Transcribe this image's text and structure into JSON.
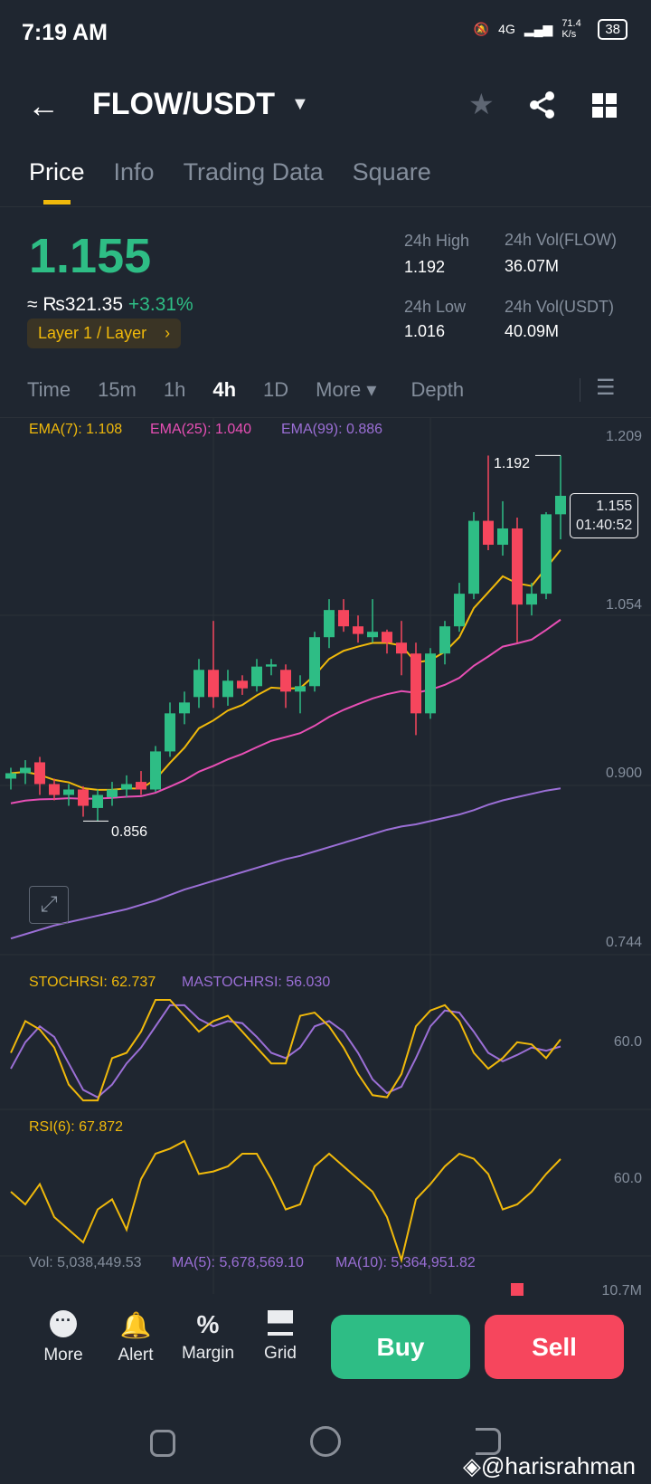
{
  "status": {
    "time": "7:19 AM",
    "net": "4G",
    "speed": "71.4 K/s",
    "battery": "38"
  },
  "header": {
    "title": "FLOW/USDT"
  },
  "tabs": [
    "Price",
    "Info",
    "Trading Data",
    "Square"
  ],
  "ticker": {
    "price": "1.155",
    "fiat": "≈ ₨321.35",
    "change": "+3.31%",
    "tag": "Layer 1 / Layer",
    "high_label": "24h High",
    "high": "1.192",
    "low_label": "24h Low",
    "low": "1.016",
    "volb_label": "24h Vol(FLOW)",
    "volb": "36.07M",
    "volq_label": "24h Vol(USDT)",
    "volq": "40.09M"
  },
  "timeframes": [
    "Time",
    "15m",
    "1h",
    "4h",
    "1D",
    "More",
    "Depth"
  ],
  "legend": {
    "ema7": "EMA(7): 1.108",
    "ema25": "EMA(25): 1.040",
    "ema99": "EMA(99): 0.886",
    "stoch": "STOCHRSI: 62.737",
    "mastoch": "MASTOCHRSI: 56.030",
    "rsi": "RSI(6): 67.872",
    "vol": "Vol: 5,038,449.53",
    "ma5": "MA(5): 5,678,569.10",
    "ma10": "MA(10): 5,364,951.82"
  },
  "axis": {
    "p1": "1.209",
    "p2": "1.054",
    "p3": "0.900",
    "p4": "0.744",
    "stoch": "60.0",
    "rsi": "60.0",
    "vol": "10.7M"
  },
  "markers": {
    "high": "1.192",
    "low": "0.856",
    "last": "1.155",
    "countdown": "01:40:52"
  },
  "bottom": {
    "more": "More",
    "alert": "Alert",
    "margin": "Margin",
    "grid": "Grid",
    "buy": "Buy",
    "sell": "Sell"
  },
  "watermark": "@harisrahman",
  "colors": {
    "up": "#2ebd85",
    "down": "#f6465d",
    "ema7": "#f0b90b",
    "ema25": "#e84fb5",
    "ema99": "#9b6fd6"
  },
  "chart_data": {
    "type": "candlestick",
    "ylim": [
      0.744,
      1.209
    ],
    "candles": [
      [
        0.895,
        0.905,
        0.885,
        0.9
      ],
      [
        0.9,
        0.912,
        0.89,
        0.905
      ],
      [
        0.91,
        0.915,
        0.88,
        0.89
      ],
      [
        0.89,
        0.895,
        0.875,
        0.88
      ],
      [
        0.88,
        0.89,
        0.87,
        0.885
      ],
      [
        0.885,
        0.888,
        0.86,
        0.87
      ],
      [
        0.868,
        0.885,
        0.856,
        0.88
      ],
      [
        0.878,
        0.892,
        0.87,
        0.885
      ],
      [
        0.885,
        0.898,
        0.878,
        0.89
      ],
      [
        0.892,
        0.902,
        0.88,
        0.885
      ],
      [
        0.885,
        0.925,
        0.883,
        0.92
      ],
      [
        0.92,
        0.965,
        0.915,
        0.955
      ],
      [
        0.955,
        0.975,
        0.945,
        0.965
      ],
      [
        0.97,
        1.005,
        0.96,
        0.995
      ],
      [
        0.995,
        1.04,
        0.96,
        0.97
      ],
      [
        0.97,
        0.995,
        0.962,
        0.985
      ],
      [
        0.985,
        0.99,
        0.972,
        0.978
      ],
      [
        0.98,
        1.005,
        0.975,
        0.998
      ],
      [
        0.998,
        1.005,
        0.99,
        1.0
      ],
      [
        0.995,
        1.0,
        0.96,
        0.975
      ],
      [
        0.975,
        0.99,
        0.955,
        0.98
      ],
      [
        0.98,
        1.03,
        0.975,
        1.025
      ],
      [
        1.025,
        1.06,
        1.015,
        1.05
      ],
      [
        1.05,
        1.06,
        1.03,
        1.035
      ],
      [
        1.035,
        1.045,
        1.02,
        1.028
      ],
      [
        1.025,
        1.06,
        1.02,
        1.03
      ],
      [
        1.03,
        1.032,
        1.01,
        1.02
      ],
      [
        1.02,
        1.04,
        0.99,
        1.01
      ],
      [
        1.01,
        1.02,
        0.935,
        0.955
      ],
      [
        0.955,
        1.015,
        0.95,
        1.01
      ],
      [
        1.01,
        1.04,
        1.0,
        1.035
      ],
      [
        1.035,
        1.075,
        1.03,
        1.065
      ],
      [
        1.065,
        1.14,
        1.06,
        1.132
      ],
      [
        1.132,
        1.192,
        1.105,
        1.11
      ],
      [
        1.11,
        1.15,
        1.1,
        1.125
      ],
      [
        1.125,
        1.135,
        1.02,
        1.055
      ],
      [
        1.055,
        1.075,
        1.045,
        1.065
      ],
      [
        1.065,
        1.14,
        1.06,
        1.138
      ],
      [
        1.138,
        1.192,
        1.115,
        1.155
      ]
    ],
    "ema99": [
      0.748,
      0.752,
      0.756,
      0.76,
      0.763,
      0.766,
      0.769,
      0.772,
      0.775,
      0.779,
      0.783,
      0.788,
      0.793,
      0.797,
      0.801,
      0.805,
      0.809,
      0.813,
      0.817,
      0.821,
      0.824,
      0.828,
      0.832,
      0.836,
      0.84,
      0.844,
      0.848,
      0.851,
      0.853,
      0.856,
      0.859,
      0.862,
      0.866,
      0.871,
      0.875,
      0.878,
      0.881,
      0.884,
      0.886
    ],
    "stoch_k": [
      50,
      80,
      72,
      55,
      20,
      5,
      5,
      45,
      50,
      70,
      100,
      100,
      85,
      70,
      80,
      85,
      70,
      55,
      40,
      40,
      85,
      88,
      75,
      55,
      30,
      10,
      8,
      30,
      75,
      90,
      95,
      80,
      50,
      35,
      45,
      60,
      58,
      45,
      62.7
    ],
    "stoch_d": [
      35,
      60,
      75,
      65,
      40,
      15,
      8,
      20,
      40,
      55,
      75,
      95,
      95,
      82,
      75,
      80,
      78,
      65,
      50,
      45,
      55,
      75,
      80,
      70,
      50,
      25,
      12,
      18,
      45,
      75,
      90,
      88,
      70,
      50,
      42,
      48,
      55,
      52,
      56
    ],
    "rsi": [
      55,
      50,
      58,
      45,
      40,
      35,
      48,
      52,
      40,
      60,
      70,
      72,
      75,
      62,
      63,
      65,
      70,
      70,
      60,
      48,
      50,
      65,
      70,
      65,
      60,
      55,
      45,
      28,
      52,
      58,
      65,
      70,
      68,
      62,
      48,
      50,
      55,
      62,
      67.9
    ]
  }
}
